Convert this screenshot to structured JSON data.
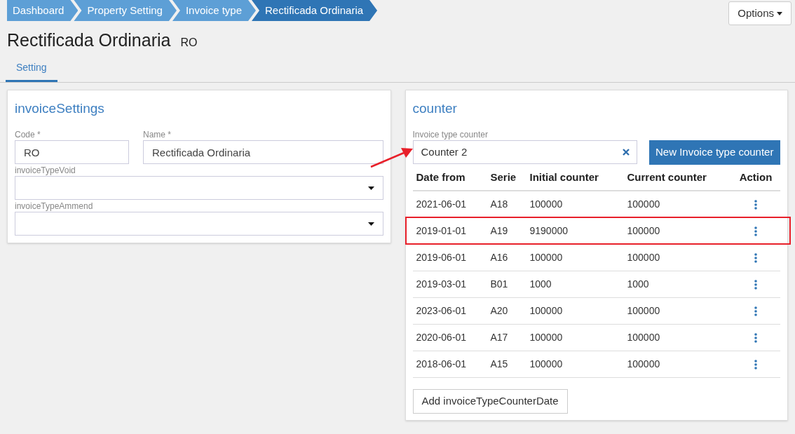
{
  "breadcrumb": [
    {
      "label": "Dashboard",
      "selected": false
    },
    {
      "label": "Property Setting",
      "selected": false
    },
    {
      "label": "Invoice type",
      "selected": false
    },
    {
      "label": "Rectificada Ordinaria",
      "selected": true
    }
  ],
  "options_button": "Options",
  "title": "Rectificada Ordinaria",
  "code": "RO",
  "tabs": [
    {
      "label": "Setting",
      "selected": true
    }
  ],
  "invoice_settings": {
    "title": "invoiceSettings",
    "fields": [
      {
        "kind": "text",
        "label": "Code *",
        "value": "RO"
      },
      {
        "kind": "text",
        "label": "Name *",
        "value": "Rectificada Ordinaria"
      },
      {
        "kind": "select",
        "label": "invoiceTypeVoid"
      },
      {
        "kind": "select",
        "label": "invoiceTypeAmmend"
      }
    ]
  },
  "counter": {
    "title": "counter",
    "select_label": "Invoice type counter",
    "select_value": "Counter 2",
    "new_button": "New Invoice type counter",
    "columns": [
      "Date from",
      "Serie",
      "Initial counter",
      "Current counter",
      "Action"
    ],
    "rows": [
      {
        "cells": [
          "2021-06-01",
          "A18",
          "100000",
          "100000"
        ],
        "highlighted": false
      },
      {
        "cells": [
          "2019-01-01",
          "A19",
          "9190000",
          "100000"
        ],
        "highlighted": true
      },
      {
        "cells": [
          "2019-06-01",
          "A16",
          "100000",
          "100000"
        ],
        "highlighted": false
      },
      {
        "cells": [
          "2019-03-01",
          "B01",
          "1000",
          "1000"
        ],
        "highlighted": false
      },
      {
        "cells": [
          "2023-06-01",
          "A20",
          "100000",
          "100000"
        ],
        "highlighted": false
      },
      {
        "cells": [
          "2020-06-01",
          "A17",
          "100000",
          "100000"
        ],
        "highlighted": false
      },
      {
        "cells": [
          "2018-06-01",
          "A15",
          "100000",
          "100000"
        ],
        "highlighted": false
      }
    ],
    "add_button": "Add invoiceTypeCounterDate"
  }
}
